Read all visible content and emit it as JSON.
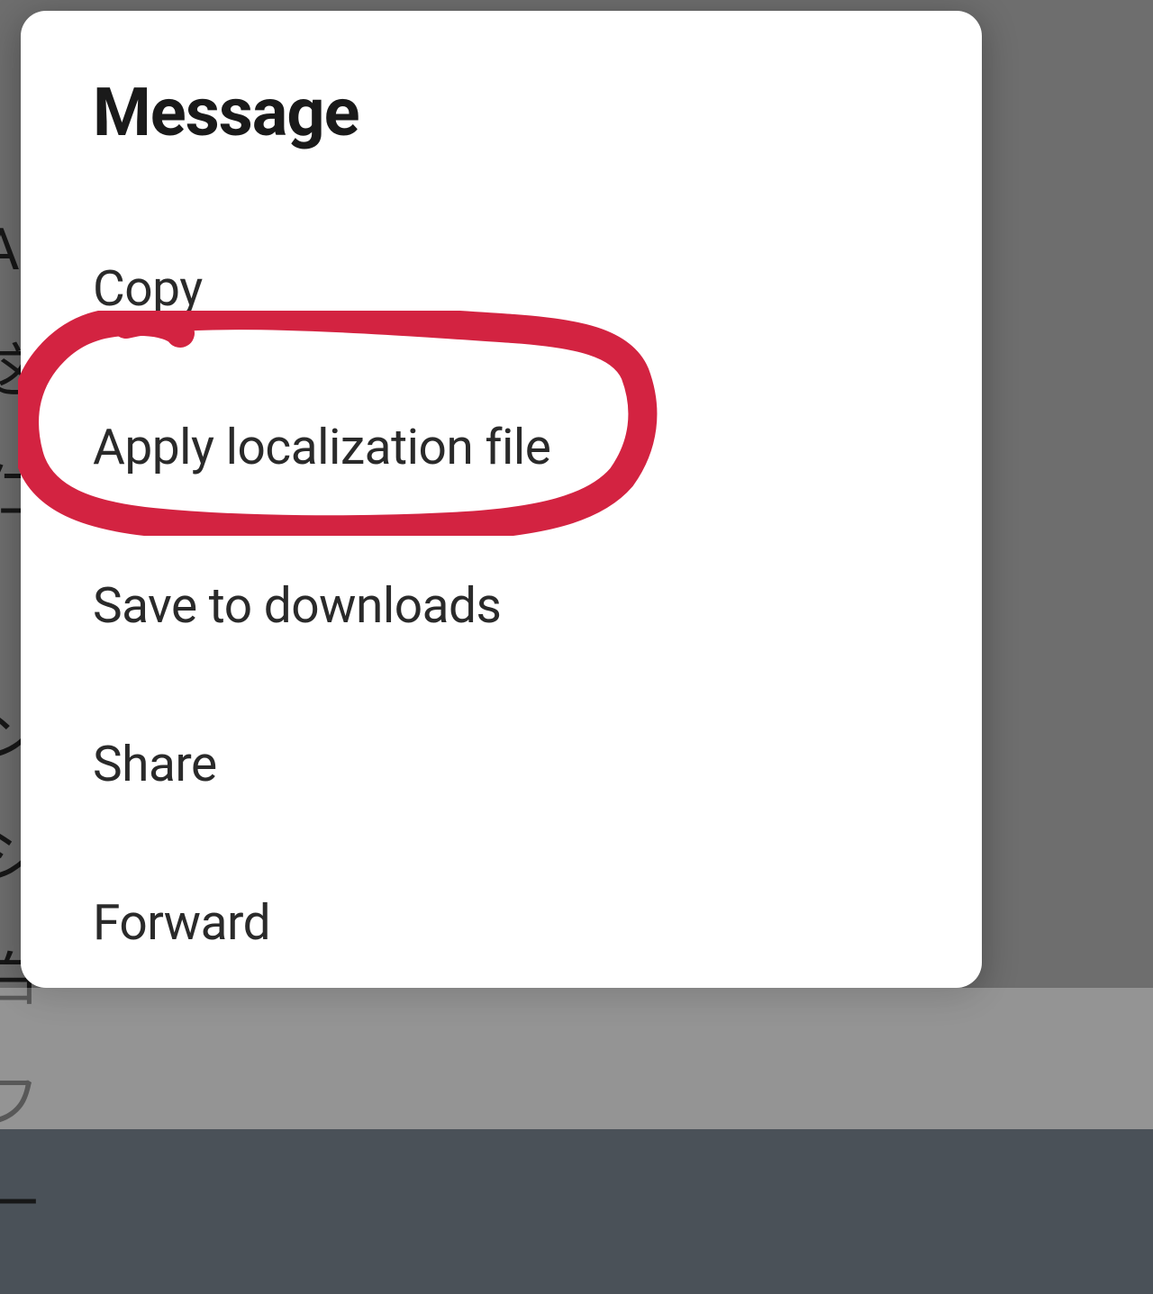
{
  "dialog": {
    "title": "Message",
    "items": [
      {
        "label": "Copy"
      },
      {
        "label": "Apply localization file"
      },
      {
        "label": "Save to downloads"
      },
      {
        "label": "Share"
      },
      {
        "label": "Forward"
      }
    ]
  },
  "annotation": {
    "color": "#d32341",
    "highlighted_item_index": 1
  }
}
